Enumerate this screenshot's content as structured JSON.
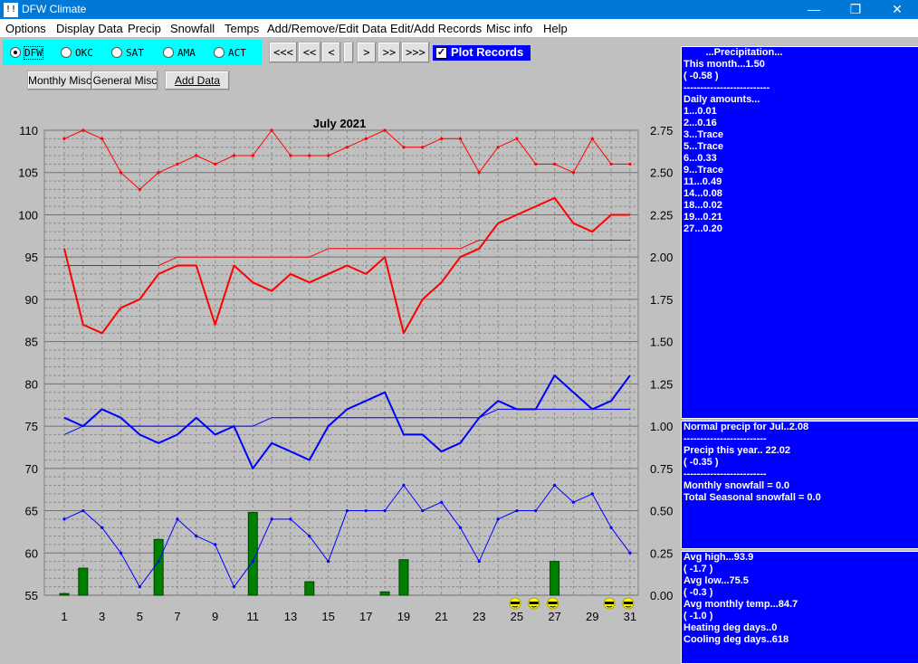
{
  "window": {
    "title": "DFW Climate",
    "icon_text": "!!",
    "minimize": "—",
    "maximize": "❐",
    "close": "✕"
  },
  "menu": [
    "Options",
    "Display Data",
    "Precip",
    "Snowfall",
    "Temps",
    "Add/Remove/Edit Data",
    "Edit/Add Records",
    "Misc info",
    "Help"
  ],
  "stations": {
    "items": [
      "DFW",
      "OKC",
      "SAT",
      "AMA",
      "ACT"
    ],
    "selected": "DFW"
  },
  "nav": [
    "<<<",
    "<<",
    "<",
    "",
    ">",
    ">>",
    ">>>"
  ],
  "plot_records": {
    "label": "Plot Records",
    "checked": true,
    "mark": "✓"
  },
  "buttons": {
    "monthly_misc": "Monthly Misc",
    "general_misc": "General Misc",
    "add_data": "Add Data"
  },
  "colors": {
    "accent": "#0000ff",
    "high": "#ff0000",
    "low": "#0000ff",
    "precip": "#008000"
  },
  "chart_data": {
    "type": "line",
    "title": "July 2021",
    "x": [
      1,
      2,
      3,
      4,
      5,
      6,
      7,
      8,
      9,
      10,
      11,
      12,
      13,
      14,
      15,
      16,
      17,
      18,
      19,
      20,
      21,
      22,
      23,
      24,
      25,
      26,
      27,
      28,
      29,
      30,
      31
    ],
    "xticks": [
      1,
      3,
      5,
      7,
      9,
      11,
      13,
      15,
      17,
      19,
      21,
      23,
      25,
      27,
      29,
      31
    ],
    "ylim": [
      55,
      110
    ],
    "yticks": [
      55,
      60,
      65,
      70,
      75,
      80,
      85,
      90,
      95,
      100,
      105,
      110
    ],
    "y2lim": [
      0,
      2.75
    ],
    "y2ticks": [
      "0.00",
      "0.25",
      "0.50",
      "0.75",
      "1.00",
      "1.25",
      "1.50",
      "1.75",
      "2.00",
      "2.25",
      "2.50",
      "2.75"
    ],
    "grid": true,
    "series": [
      {
        "role": "record-high",
        "color": "#ff0000",
        "width": 1,
        "markers": true,
        "values": [
          109,
          110,
          109,
          105,
          103,
          105,
          106,
          107,
          106,
          107,
          107,
          110,
          107,
          107,
          107,
          108,
          109,
          110,
          108,
          108,
          109,
          109,
          105,
          108,
          109,
          106,
          106,
          105,
          109,
          106,
          106
        ]
      },
      {
        "role": "high",
        "color": "#ff0000",
        "width": 2,
        "markers": false,
        "values": [
          96,
          87,
          86,
          89,
          90,
          93,
          94,
          94,
          87,
          94,
          92,
          91,
          93,
          92,
          93,
          94,
          93,
          95,
          86,
          90,
          92,
          95,
          96,
          99,
          100,
          101,
          102,
          99,
          98,
          100,
          100
        ]
      },
      {
        "role": "normal-high",
        "color": "#ff0000",
        "width": 1,
        "markers": false,
        "values": [
          94,
          94,
          94,
          94,
          94,
          94,
          95,
          95,
          95,
          95,
          95,
          95,
          95,
          95,
          96,
          96,
          96,
          96,
          96,
          96,
          96,
          96,
          97,
          97,
          97,
          97,
          97,
          97,
          97,
          97,
          97
        ]
      },
      {
        "role": "low",
        "color": "#0000ff",
        "width": 2,
        "markers": false,
        "values": [
          76,
          75,
          77,
          76,
          74,
          73,
          74,
          76,
          74,
          75,
          70,
          73,
          72,
          71,
          75,
          77,
          78,
          79,
          74,
          74,
          72,
          73,
          76,
          78,
          77,
          77,
          81,
          79,
          77,
          78,
          81
        ]
      },
      {
        "role": "normal-low",
        "color": "#0000ff",
        "width": 1,
        "markers": false,
        "values": [
          74,
          75,
          75,
          75,
          75,
          75,
          75,
          75,
          75,
          75,
          75,
          76,
          76,
          76,
          76,
          76,
          76,
          76,
          76,
          76,
          76,
          76,
          76,
          77,
          77,
          77,
          77,
          77,
          77,
          77,
          77
        ]
      },
      {
        "role": "record-low",
        "color": "#0000ff",
        "width": 1,
        "markers": true,
        "values": [
          64,
          65,
          63,
          60,
          56,
          59,
          64,
          62,
          61,
          56,
          59,
          64,
          64,
          62,
          59,
          65,
          65,
          65,
          68,
          65,
          66,
          63,
          59,
          64,
          65,
          65,
          68,
          66,
          67,
          63,
          60
        ]
      }
    ],
    "precip_bars": {
      "color": "#008000",
      "days": [
        1,
        2,
        6,
        10,
        11,
        14,
        18,
        19,
        27
      ],
      "values": [
        0.01,
        0.16,
        0.33,
        0.0,
        0.49,
        0.08,
        0.02,
        0.21,
        0.2
      ],
      "trace_days": [
        3,
        5,
        9
      ]
    },
    "sun_days": [
      25,
      26,
      27,
      30,
      31
    ]
  },
  "panel_precip": [
    "        ...Precipitation...",
    "This month...1.50",
    "( -0.58 )",
    "--------------------------",
    "Daily amounts...",
    "1...0.01",
    "2...0.16",
    "3...Trace",
    "5...Trace",
    "6...0.33",
    "9...Trace",
    "11...0.49",
    "14...0.08",
    "18...0.02",
    "19...0.21",
    "27...0.20"
  ],
  "panel_normal": [
    "Normal precip for Jul..2.08",
    "-------------------------",
    "Precip this year.. 22.02",
    "( -0.35 )",
    "-------------------------",
    "Monthly snowfall = 0.0",
    "Total Seasonal snowfall = 0.0"
  ],
  "panel_temps": [
    "Avg high...93.9",
    "( -1.7 )",
    "Avg low...75.5",
    "( -0.3 )",
    "Avg monthly temp...84.7",
    "( -1.0 )",
    "Heating deg days..0",
    "Cooling deg days..618"
  ]
}
